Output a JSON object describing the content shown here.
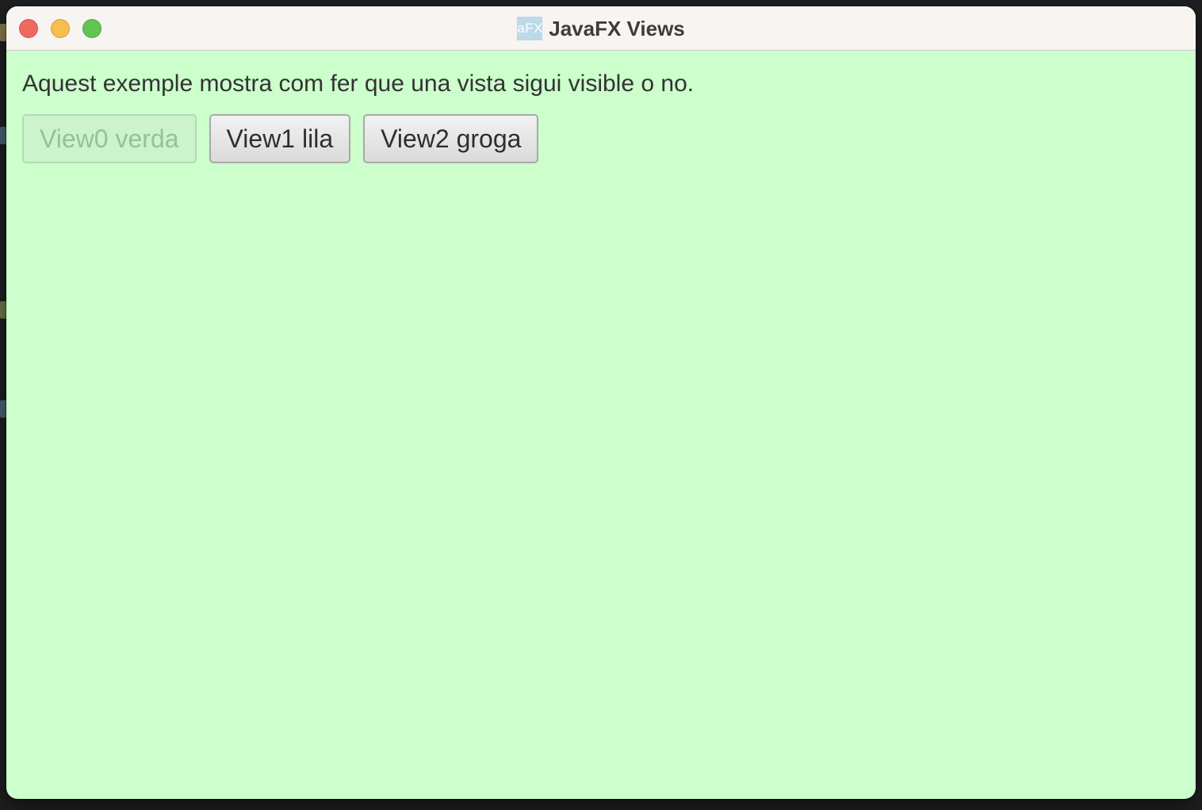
{
  "window": {
    "title": "JavaFX Views",
    "icon_text": "aFX",
    "background_color": "#ccffcc"
  },
  "content": {
    "intro_text": "Aquest exemple mostra com fer que una vista sigui visible o no.",
    "buttons": [
      {
        "label": "View0 verda",
        "enabled": false
      },
      {
        "label": "View1 lila",
        "enabled": true
      },
      {
        "label": "View2 groga",
        "enabled": true
      }
    ]
  },
  "colors": {
    "close": "#ed6a5e",
    "minimize": "#f5bf4f",
    "zoom": "#61c554"
  }
}
